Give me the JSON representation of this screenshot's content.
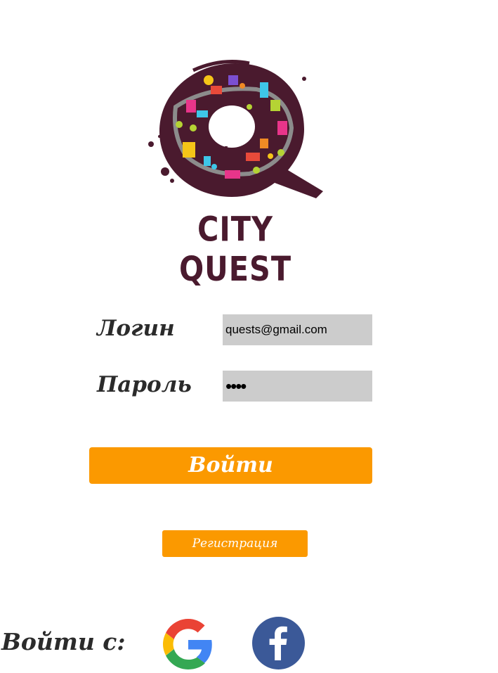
{
  "logo": {
    "text": "CITY QUEST",
    "colors": {
      "dark": "#4a1a2e",
      "accents": [
        "#f5c518",
        "#e8358a",
        "#3ec6e8",
        "#b5d334",
        "#e84a3a",
        "#7b4fd1",
        "#f08a24"
      ]
    }
  },
  "form": {
    "login_label": "Логин",
    "login_value": "quests@gmail.com",
    "password_label": "Пароль",
    "password_value": "••••"
  },
  "buttons": {
    "login_label": "Войти",
    "register_label": "Регистрация"
  },
  "social": {
    "label": "Войти с:",
    "providers": [
      {
        "name": "google",
        "icon": "google-icon"
      },
      {
        "name": "facebook",
        "icon": "facebook-icon"
      }
    ]
  },
  "colors": {
    "accent": "#fb9900",
    "field_bg": "#cccccc",
    "text": "#2b2b2b",
    "facebook_blue": "#3b5998"
  }
}
